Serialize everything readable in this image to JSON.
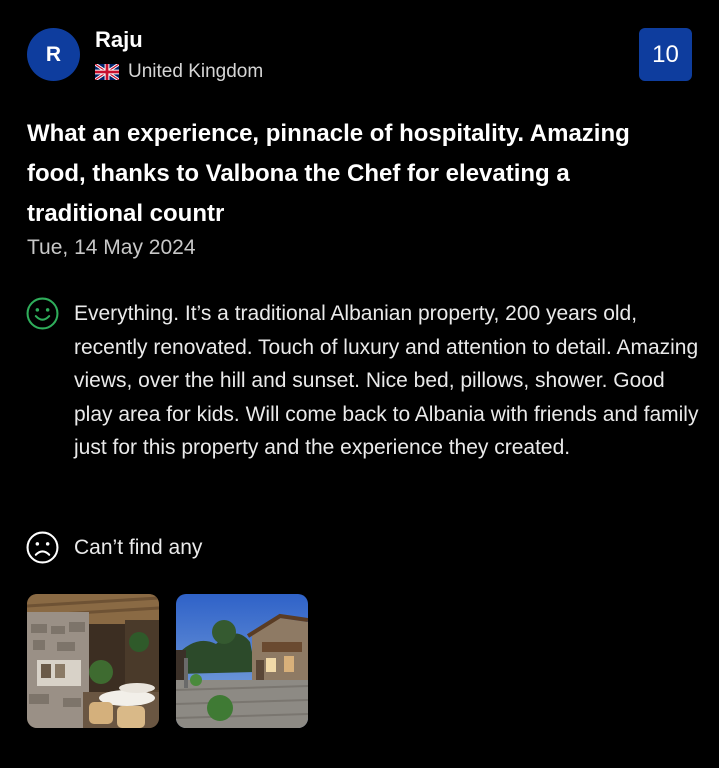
{
  "reviewer": {
    "initial": "R",
    "name": "Raju",
    "country": "United Kingdom",
    "flag_icon": "uk-flag-icon"
  },
  "score": "10",
  "review": {
    "title": "What an experience, pinnacle of hospitality. Amazing food, thanks to Valbona the Chef for elevating a traditional countr",
    "date": "Tue, 14 May 2024"
  },
  "liked": {
    "icon": "smile-face-icon",
    "text": "Everything. It’s a traditional Albanian property, 200 years old, recently renovated. Touch of luxury and attention to detail. Amazing views, over the hill and sunset. Nice bed, pillows, shower. Good play area for kids. Will come back to Albania with friends and family just for this property and the experience they created."
  },
  "disliked": {
    "icon": "frown-face-icon",
    "text": "Can’t find any"
  },
  "colors": {
    "background": "#000000",
    "accent": "#0e3d9e",
    "positive": "#2fae5b",
    "text": "#ffffff",
    "muted": "#c8c8c8"
  }
}
